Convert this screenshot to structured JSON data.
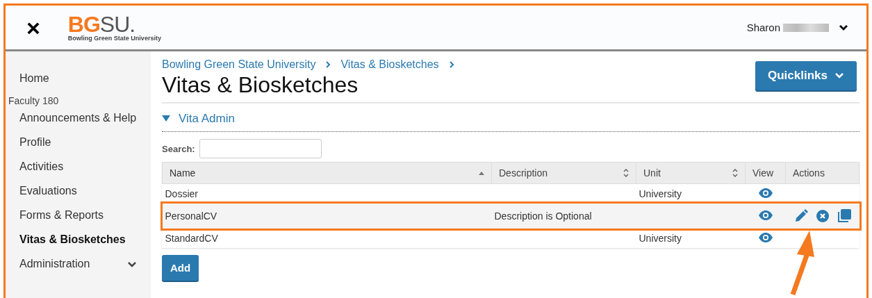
{
  "header": {
    "close_glyph": "×",
    "logo": {
      "accent": "BG",
      "rest": "SU.",
      "tagline": "Bowling Green State University"
    },
    "user": {
      "name": "Sharon",
      "redacted": true
    }
  },
  "sidebar": {
    "items": [
      {
        "kind": "link",
        "label": "Home",
        "selected": false,
        "expandable": false
      },
      {
        "kind": "heading",
        "label": "Faculty 180"
      },
      {
        "kind": "link",
        "label": "Announcements & Help",
        "selected": false,
        "expandable": false
      },
      {
        "kind": "link",
        "label": "Profile",
        "selected": false,
        "expandable": false
      },
      {
        "kind": "link",
        "label": "Activities",
        "selected": false,
        "expandable": false
      },
      {
        "kind": "link",
        "label": "Evaluations",
        "selected": false,
        "expandable": false
      },
      {
        "kind": "link",
        "label": "Forms & Reports",
        "selected": false,
        "expandable": false
      },
      {
        "kind": "link",
        "label": "Vitas & Biosketches",
        "selected": true,
        "expandable": false
      },
      {
        "kind": "link",
        "label": "Administration",
        "selected": false,
        "expandable": true
      }
    ]
  },
  "breadcrumbs": [
    "Bowling Green State University",
    "Vitas & Biosketches"
  ],
  "page_title": "Vitas & Biosketches",
  "quicklinks": {
    "label": "Quicklinks"
  },
  "section": {
    "title": "Vita Admin",
    "expanded": true
  },
  "search": {
    "label": "Search:"
  },
  "table": {
    "columns": [
      {
        "label": "Name",
        "sortable": true,
        "sorted": true
      },
      {
        "label": "Description",
        "sortable": true,
        "sorted": false
      },
      {
        "label": "Unit",
        "sortable": true,
        "sorted": false
      },
      {
        "label": "View",
        "sortable": false,
        "sorted": false
      },
      {
        "label": "Actions",
        "sortable": false,
        "sorted": false
      }
    ],
    "rows": [
      {
        "name": "Dossier",
        "unit": "University",
        "highlighted": false,
        "actions_visible": false
      },
      {
        "name": "PersonalCV",
        "description": "Description is Optional",
        "highlighted": true,
        "actions_visible": true
      },
      {
        "name": "StandardCV",
        "unit": "University",
        "highlighted": false,
        "actions_visible": false
      }
    ]
  },
  "add_button": {
    "label": "Add"
  },
  "annotation": {
    "arrow": true
  }
}
